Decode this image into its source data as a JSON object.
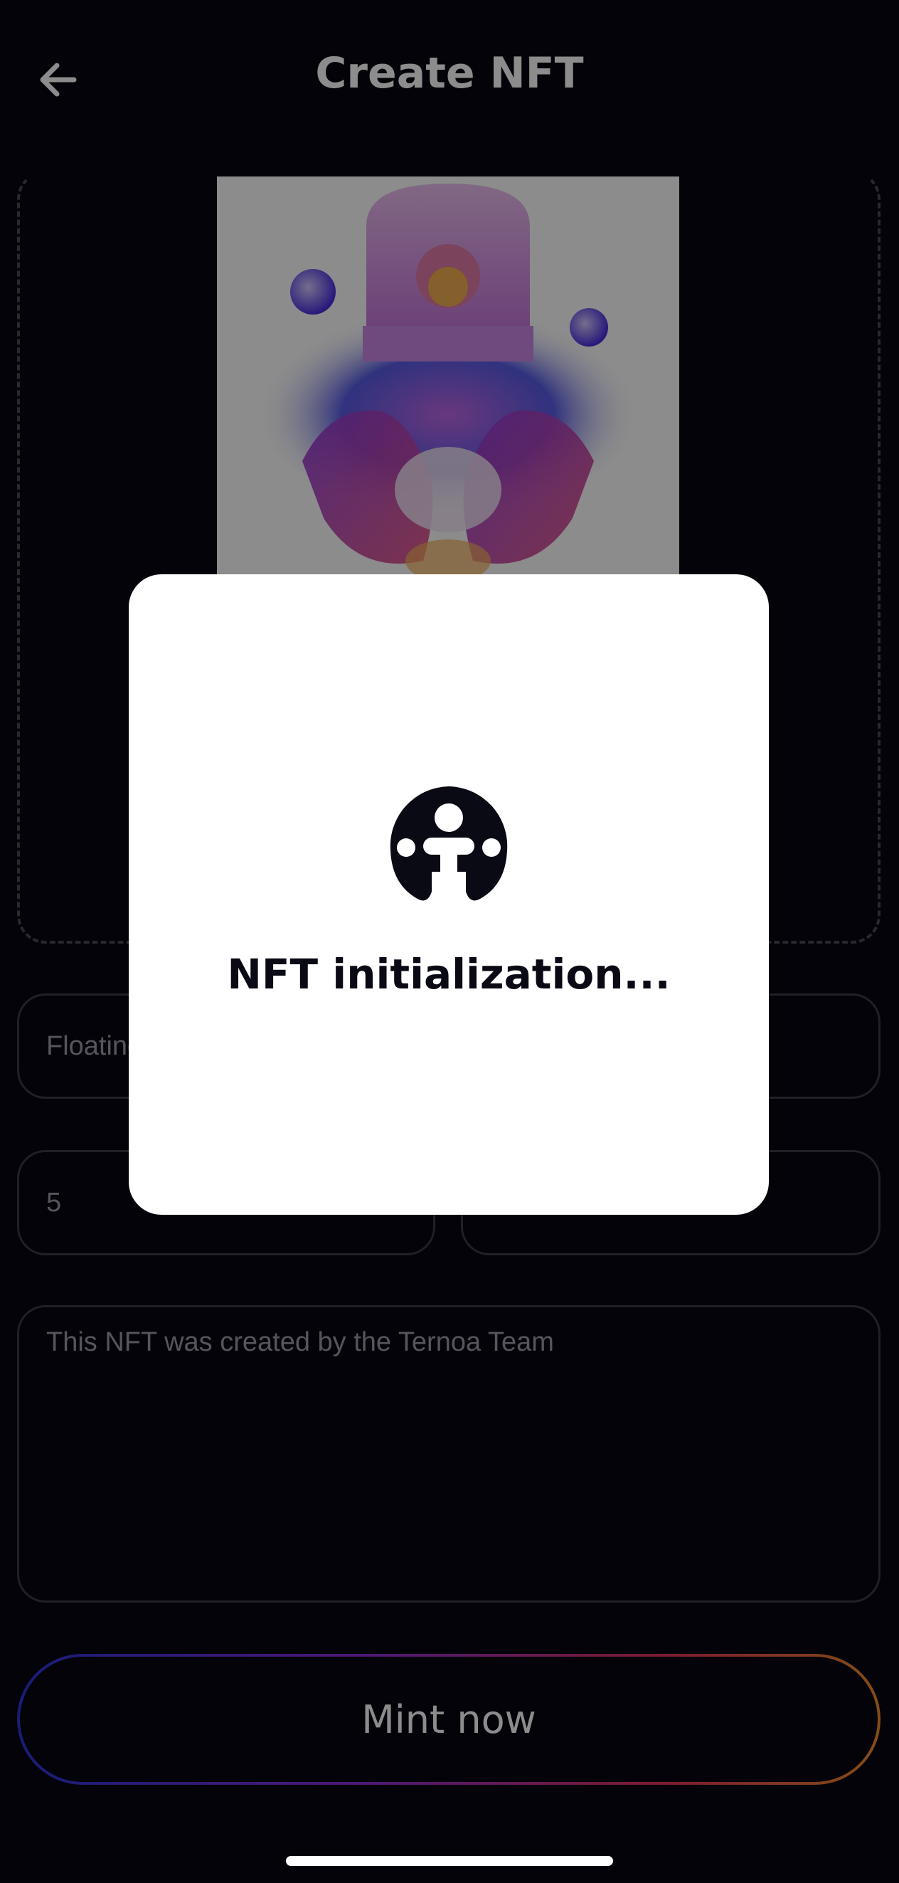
{
  "header": {
    "title": "Create NFT",
    "back_icon": "arrow-left-icon"
  },
  "form": {
    "name_value": "Floating",
    "quantity_value": "5",
    "royalty_value": "",
    "description_value": "This NFT was created by the Ternoa Team"
  },
  "mint_button": {
    "label": "Mint now"
  },
  "modal": {
    "logo_icon": "ternoa-logo-icon",
    "message": "NFT initialization..."
  },
  "colors": {
    "background": "#070611",
    "modal": "#ffffff",
    "gradient": [
      "#2d36d8",
      "#8c2bd6",
      "#e0345a",
      "#f08a2a"
    ]
  }
}
